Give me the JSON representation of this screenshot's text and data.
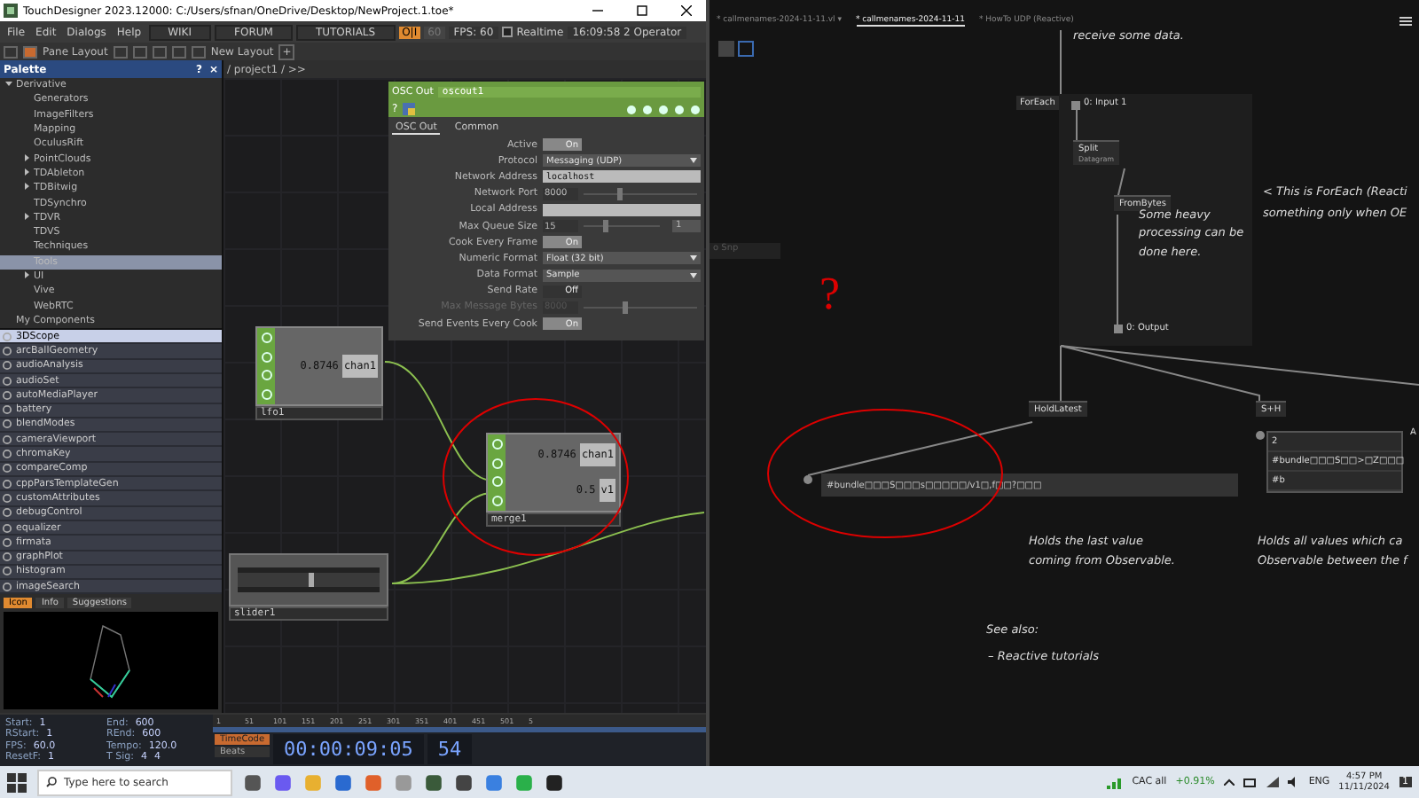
{
  "td_window": {
    "title": "TouchDesigner 2023.12000: C:/Users/sfnan/OneDrive/Desktop/NewProject.1.toe*",
    "menu": [
      "File",
      "Edit",
      "Dialogs",
      "Help"
    ],
    "links": [
      "WIKI",
      "FORUM",
      "TUTORIALS"
    ],
    "perf_toggle": "O|I",
    "fps_cap": "60",
    "fps": "FPS:  60",
    "realtime": {
      "label": "Realtime",
      "checked": false
    },
    "status": "16:09:58 2 Operator",
    "toolbar": {
      "pane_layout": "Pane Layout",
      "new_layout": "New Layout",
      "add": "+"
    },
    "palette": {
      "title": "Palette",
      "help": "?",
      "close": "×",
      "tree": [
        {
          "label": "Derivative",
          "expanded": true,
          "selected": false,
          "children": [
            {
              "label": "Generators",
              "selected": false
            },
            {
              "label": "ImageFilters",
              "selected": false
            },
            {
              "label": "Mapping",
              "selected": false
            },
            {
              "label": "OculusRift",
              "selected": false
            },
            {
              "label": "PointClouds",
              "expanded": false,
              "selected": false
            },
            {
              "label": "TDAbleton",
              "expanded": false,
              "selected": false
            },
            {
              "label": "TDBitwig",
              "expanded": false,
              "selected": false
            },
            {
              "label": "TDSynchro",
              "selected": false
            },
            {
              "label": "TDVR",
              "expanded": false,
              "selected": false
            },
            {
              "label": "TDVS",
              "selected": false
            },
            {
              "label": "Techniques",
              "selected": false
            },
            {
              "label": "Tools",
              "selected": true
            },
            {
              "label": "UI",
              "expanded": false,
              "selected": false
            },
            {
              "label": "Vive",
              "selected": false
            },
            {
              "label": "WebRTC",
              "selected": false
            }
          ]
        },
        {
          "label": "My Components",
          "selected": false
        }
      ],
      "components": [
        {
          "label": "3DScope",
          "selected": true
        },
        {
          "label": "arcBallGeometry",
          "selected": false
        },
        {
          "label": "audioAnalysis",
          "selected": false
        },
        {
          "label": "audioSet",
          "selected": false
        },
        {
          "label": "autoMediaPlayer",
          "selected": false
        },
        {
          "label": "battery",
          "selected": false
        },
        {
          "label": "blendModes",
          "selected": false
        },
        {
          "label": "cameraViewport",
          "selected": false
        },
        {
          "label": "chromaKey",
          "selected": false
        },
        {
          "label": "compareComp",
          "selected": false
        },
        {
          "label": "cppParsTemplateGen",
          "selected": false
        },
        {
          "label": "customAttributes",
          "selected": false
        },
        {
          "label": "debugControl",
          "selected": false
        },
        {
          "label": "equalizer",
          "selected": false
        },
        {
          "label": "firmata",
          "selected": false
        },
        {
          "label": "graphPlot",
          "selected": false
        },
        {
          "label": "histogram",
          "selected": false
        },
        {
          "label": "imageSearch",
          "selected": false
        }
      ],
      "preview_tabs": [
        {
          "label": "Icon",
          "selected": true
        },
        {
          "label": "Info",
          "selected": false
        },
        {
          "label": "Suggestions",
          "selected": false
        }
      ]
    },
    "network": {
      "path": "/ project1 / >>",
      "params": {
        "type": "OSC Out",
        "name": "oscout1",
        "help": "?",
        "tabs": [
          {
            "label": "OSC Out",
            "selected": true
          },
          {
            "label": "Common",
            "selected": false
          }
        ],
        "rows": [
          {
            "label": "Active",
            "kind": "toggle",
            "value": "On",
            "on": true,
            "disabled": false
          },
          {
            "label": "Protocol",
            "kind": "menu",
            "value": "Messaging (UDP)",
            "disabled": false
          },
          {
            "label": "Network Address",
            "kind": "text",
            "value": "localhost",
            "disabled": false
          },
          {
            "label": "Network Port",
            "kind": "slider",
            "value": "8000",
            "level": 0.3,
            "disabled": false
          },
          {
            "label": "Local Address",
            "kind": "text",
            "disabled": false
          },
          {
            "label": "Max Queue Size",
            "kind": "slider",
            "value": "15",
            "level": 0.25,
            "extra": "1",
            "disabled": false
          },
          {
            "label": "Cook Every Frame",
            "kind": "toggle",
            "value": "On",
            "on": true,
            "disabled": false
          },
          {
            "label": "Numeric Format",
            "kind": "menu",
            "value": "Float (32 bit)",
            "disabled": false
          },
          {
            "label": "Data Format",
            "kind": "menu",
            "value": "Sample",
            "disabled": false
          },
          {
            "label": "Send Rate",
            "kind": "toggle",
            "value": "Off",
            "on": false,
            "disabled": false
          },
          {
            "label": "Max Message Bytes",
            "kind": "slider",
            "value": "8000",
            "level": 0.35,
            "disabled": true
          },
          {
            "label": "Send Events Every Cook",
            "kind": "toggle",
            "value": "On",
            "on": true,
            "disabled": false
          }
        ]
      },
      "nodes": [
        {
          "kind": "chop",
          "name": "lfo1",
          "channels": [
            {
              "value": "0.8746",
              "name": "chan1"
            }
          ]
        },
        {
          "kind": "chop",
          "name": "merge1",
          "channels": [
            {
              "value": "0.8746",
              "name": "chan1"
            },
            {
              "value": "0.5",
              "name": "v1"
            }
          ]
        },
        {
          "kind": "slider",
          "name": "slider1",
          "level": 0.5
        }
      ]
    },
    "timeline": {
      "fields": [
        {
          "label": "Start:",
          "value": "1"
        },
        {
          "label": "End:",
          "value": "600"
        },
        {
          "label": "RStart:",
          "value": "1"
        },
        {
          "label": "REnd:",
          "value": "600"
        },
        {
          "label": "FPS:",
          "value": "60.0"
        },
        {
          "label": "Tempo:",
          "value": "120.0"
        },
        {
          "label": "ResetF:",
          "value": "1"
        },
        {
          "label": "T Sig:",
          "value": "4",
          "value2": "4"
        }
      ],
      "ruler": [
        "1",
        "51",
        "101",
        "151",
        "201",
        "251",
        "301",
        "351",
        "401",
        "451",
        "501",
        "5"
      ],
      "modes": [
        {
          "label": "TimeCode",
          "selected": true
        },
        {
          "label": "Beats",
          "selected": false
        }
      ],
      "timecode": "00:00:09:05",
      "frame": "54"
    }
  },
  "vl_window": {
    "tabs": [
      {
        "label": "* callmenames-2024-11-11.vl",
        "selected": false,
        "dropdown": "▾"
      },
      {
        "label": "* callmenames-2024-11-11",
        "selected": true
      },
      {
        "label": "* HowTo UDP (Reactive)",
        "selected": false
      }
    ],
    "hint": "o Snp",
    "comments": [
      "receive some data.",
      "Some heavy processing can be done here.",
      "< This is ForEach (Reacti",
      "something only when OE",
      "Holds the last value",
      "coming from Observable.",
      "Holds all values which ca",
      "Observable between the f",
      "See also:",
      "– Reactive tutorials"
    ],
    "region": {
      "label": "ForEach",
      "input": "0: Input 1",
      "output": "0: Output"
    },
    "nodes": [
      {
        "name": "Split",
        "sub": "Datagram"
      },
      {
        "name": "FromBytes"
      },
      {
        "name": "HoldLatest"
      },
      {
        "name": "S+H"
      }
    ],
    "bundle_value": "#bundle□□□S□□□s□□□□□/v1□,f□□?□□□",
    "sh_values": [
      "2",
      "#bundle□□□S□□>□Z□□□",
      "#b"
    ],
    "cut_label": "A",
    "annotation": "?"
  },
  "taskbar": {
    "search": "Type here to search",
    "ticker": {
      "name": "CAC all",
      "change": "+0.91%"
    },
    "lang": "ENG",
    "time": "4:57 PM",
    "date": "11/11/2024",
    "notifications": "1"
  }
}
